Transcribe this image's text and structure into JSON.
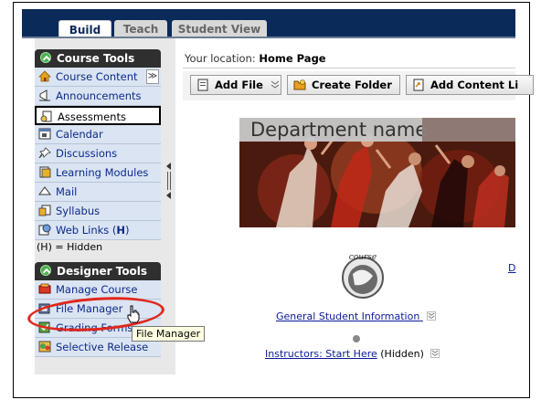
{
  "tabs": {
    "build": "Build",
    "teach": "Teach",
    "student_view": "Student View"
  },
  "course_tools": {
    "title": "Course Tools",
    "items": [
      {
        "label": "Course Content",
        "icon": "home-icon"
      },
      {
        "label": "Announcements",
        "icon": "megaphone-icon"
      },
      {
        "label": "Assessments",
        "icon": "document-icon",
        "selected": true
      },
      {
        "label": "Calendar",
        "icon": "calendar-icon"
      },
      {
        "label": "Discussions",
        "icon": "pin-icon"
      },
      {
        "label": "Learning Modules",
        "icon": "module-icon"
      },
      {
        "label": "Mail",
        "icon": "mail-icon"
      },
      {
        "label": "Syllabus",
        "icon": "syllabus-icon"
      },
      {
        "label": "Web Links (H)",
        "icon": "web-icon"
      }
    ],
    "hidden_note": "(H) = Hidden"
  },
  "designer_tools": {
    "title": "Designer Tools",
    "items": [
      {
        "label": "Manage Course",
        "icon": "manage-icon"
      },
      {
        "label": "File Manager",
        "icon": "file-manager-icon"
      },
      {
        "label": "Grading Forms",
        "icon": "grading-icon"
      },
      {
        "label": "Selective Release",
        "icon": "release-icon"
      }
    ]
  },
  "tooltip": "File Manager",
  "location": {
    "prefix": "Your location:",
    "value": "Home Page"
  },
  "toolbar": {
    "add_file": "Add File",
    "create_folder": "Create Folder",
    "add_content_link": "Add Content Li"
  },
  "banner": {
    "title": "Department name"
  },
  "content": {
    "logo_text": "course",
    "general_link": "General Student Information",
    "instructors_link": "Instructors: Start Here",
    "instructors_suffix": "(Hidden)",
    "right_link": "D"
  },
  "colors": {
    "topbar": "#0a2a5a",
    "highlight_ellipse": "#e0261c",
    "menu_bg": "#dbe4f2"
  }
}
